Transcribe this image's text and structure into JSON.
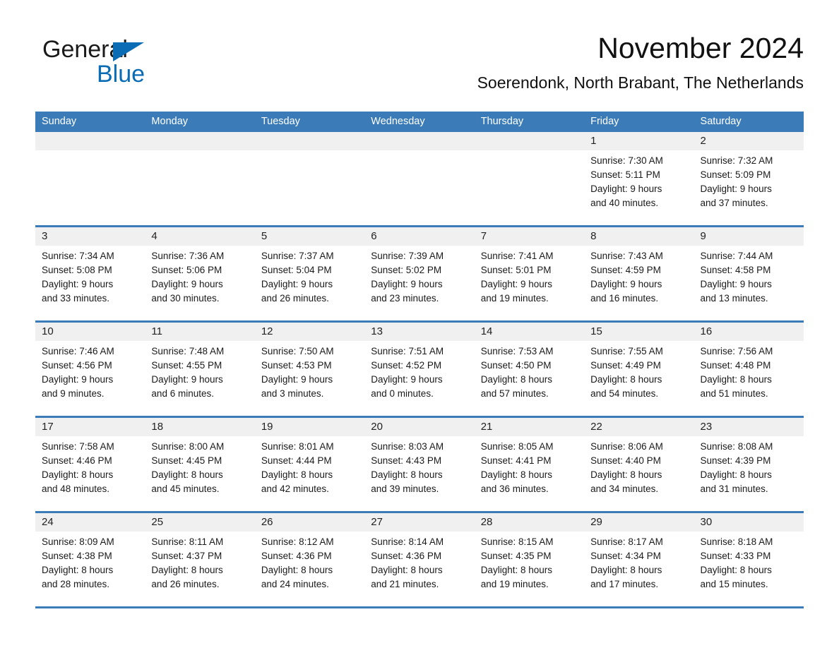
{
  "brand": {
    "name_part1": "General",
    "name_part2": "Blue",
    "triangle_color": "#0a6cb5"
  },
  "header": {
    "title": "November 2024",
    "subtitle": "Soerendonk, North Brabant, The Netherlands"
  },
  "theme": {
    "header_blue": "#3b7cb8",
    "day_band_gray": "#f0f0f0",
    "text": "#1a1a1a"
  },
  "weekdays": [
    "Sunday",
    "Monday",
    "Tuesday",
    "Wednesday",
    "Thursday",
    "Friday",
    "Saturday"
  ],
  "weeks": [
    [
      {
        "day": "",
        "empty": true,
        "sunrise": "",
        "sunset": "",
        "daylight_line1": "",
        "daylight_line2": ""
      },
      {
        "day": "",
        "empty": true,
        "sunrise": "",
        "sunset": "",
        "daylight_line1": "",
        "daylight_line2": ""
      },
      {
        "day": "",
        "empty": true,
        "sunrise": "",
        "sunset": "",
        "daylight_line1": "",
        "daylight_line2": ""
      },
      {
        "day": "",
        "empty": true,
        "sunrise": "",
        "sunset": "",
        "daylight_line1": "",
        "daylight_line2": ""
      },
      {
        "day": "",
        "empty": true,
        "sunrise": "",
        "sunset": "",
        "daylight_line1": "",
        "daylight_line2": ""
      },
      {
        "day": "1",
        "empty": false,
        "sunrise": "Sunrise: 7:30 AM",
        "sunset": "Sunset: 5:11 PM",
        "daylight_line1": "Daylight: 9 hours",
        "daylight_line2": "and 40 minutes."
      },
      {
        "day": "2",
        "empty": false,
        "sunrise": "Sunrise: 7:32 AM",
        "sunset": "Sunset: 5:09 PM",
        "daylight_line1": "Daylight: 9 hours",
        "daylight_line2": "and 37 minutes."
      }
    ],
    [
      {
        "day": "3",
        "empty": false,
        "sunrise": "Sunrise: 7:34 AM",
        "sunset": "Sunset: 5:08 PM",
        "daylight_line1": "Daylight: 9 hours",
        "daylight_line2": "and 33 minutes."
      },
      {
        "day": "4",
        "empty": false,
        "sunrise": "Sunrise: 7:36 AM",
        "sunset": "Sunset: 5:06 PM",
        "daylight_line1": "Daylight: 9 hours",
        "daylight_line2": "and 30 minutes."
      },
      {
        "day": "5",
        "empty": false,
        "sunrise": "Sunrise: 7:37 AM",
        "sunset": "Sunset: 5:04 PM",
        "daylight_line1": "Daylight: 9 hours",
        "daylight_line2": "and 26 minutes."
      },
      {
        "day": "6",
        "empty": false,
        "sunrise": "Sunrise: 7:39 AM",
        "sunset": "Sunset: 5:02 PM",
        "daylight_line1": "Daylight: 9 hours",
        "daylight_line2": "and 23 minutes."
      },
      {
        "day": "7",
        "empty": false,
        "sunrise": "Sunrise: 7:41 AM",
        "sunset": "Sunset: 5:01 PM",
        "daylight_line1": "Daylight: 9 hours",
        "daylight_line2": "and 19 minutes."
      },
      {
        "day": "8",
        "empty": false,
        "sunrise": "Sunrise: 7:43 AM",
        "sunset": "Sunset: 4:59 PM",
        "daylight_line1": "Daylight: 9 hours",
        "daylight_line2": "and 16 minutes."
      },
      {
        "day": "9",
        "empty": false,
        "sunrise": "Sunrise: 7:44 AM",
        "sunset": "Sunset: 4:58 PM",
        "daylight_line1": "Daylight: 9 hours",
        "daylight_line2": "and 13 minutes."
      }
    ],
    [
      {
        "day": "10",
        "empty": false,
        "sunrise": "Sunrise: 7:46 AM",
        "sunset": "Sunset: 4:56 PM",
        "daylight_line1": "Daylight: 9 hours",
        "daylight_line2": "and 9 minutes."
      },
      {
        "day": "11",
        "empty": false,
        "sunrise": "Sunrise: 7:48 AM",
        "sunset": "Sunset: 4:55 PM",
        "daylight_line1": "Daylight: 9 hours",
        "daylight_line2": "and 6 minutes."
      },
      {
        "day": "12",
        "empty": false,
        "sunrise": "Sunrise: 7:50 AM",
        "sunset": "Sunset: 4:53 PM",
        "daylight_line1": "Daylight: 9 hours",
        "daylight_line2": "and 3 minutes."
      },
      {
        "day": "13",
        "empty": false,
        "sunrise": "Sunrise: 7:51 AM",
        "sunset": "Sunset: 4:52 PM",
        "daylight_line1": "Daylight: 9 hours",
        "daylight_line2": "and 0 minutes."
      },
      {
        "day": "14",
        "empty": false,
        "sunrise": "Sunrise: 7:53 AM",
        "sunset": "Sunset: 4:50 PM",
        "daylight_line1": "Daylight: 8 hours",
        "daylight_line2": "and 57 minutes."
      },
      {
        "day": "15",
        "empty": false,
        "sunrise": "Sunrise: 7:55 AM",
        "sunset": "Sunset: 4:49 PM",
        "daylight_line1": "Daylight: 8 hours",
        "daylight_line2": "and 54 minutes."
      },
      {
        "day": "16",
        "empty": false,
        "sunrise": "Sunrise: 7:56 AM",
        "sunset": "Sunset: 4:48 PM",
        "daylight_line1": "Daylight: 8 hours",
        "daylight_line2": "and 51 minutes."
      }
    ],
    [
      {
        "day": "17",
        "empty": false,
        "sunrise": "Sunrise: 7:58 AM",
        "sunset": "Sunset: 4:46 PM",
        "daylight_line1": "Daylight: 8 hours",
        "daylight_line2": "and 48 minutes."
      },
      {
        "day": "18",
        "empty": false,
        "sunrise": "Sunrise: 8:00 AM",
        "sunset": "Sunset: 4:45 PM",
        "daylight_line1": "Daylight: 8 hours",
        "daylight_line2": "and 45 minutes."
      },
      {
        "day": "19",
        "empty": false,
        "sunrise": "Sunrise: 8:01 AM",
        "sunset": "Sunset: 4:44 PM",
        "daylight_line1": "Daylight: 8 hours",
        "daylight_line2": "and 42 minutes."
      },
      {
        "day": "20",
        "empty": false,
        "sunrise": "Sunrise: 8:03 AM",
        "sunset": "Sunset: 4:43 PM",
        "daylight_line1": "Daylight: 8 hours",
        "daylight_line2": "and 39 minutes."
      },
      {
        "day": "21",
        "empty": false,
        "sunrise": "Sunrise: 8:05 AM",
        "sunset": "Sunset: 4:41 PM",
        "daylight_line1": "Daylight: 8 hours",
        "daylight_line2": "and 36 minutes."
      },
      {
        "day": "22",
        "empty": false,
        "sunrise": "Sunrise: 8:06 AM",
        "sunset": "Sunset: 4:40 PM",
        "daylight_line1": "Daylight: 8 hours",
        "daylight_line2": "and 34 minutes."
      },
      {
        "day": "23",
        "empty": false,
        "sunrise": "Sunrise: 8:08 AM",
        "sunset": "Sunset: 4:39 PM",
        "daylight_line1": "Daylight: 8 hours",
        "daylight_line2": "and 31 minutes."
      }
    ],
    [
      {
        "day": "24",
        "empty": false,
        "sunrise": "Sunrise: 8:09 AM",
        "sunset": "Sunset: 4:38 PM",
        "daylight_line1": "Daylight: 8 hours",
        "daylight_line2": "and 28 minutes."
      },
      {
        "day": "25",
        "empty": false,
        "sunrise": "Sunrise: 8:11 AM",
        "sunset": "Sunset: 4:37 PM",
        "daylight_line1": "Daylight: 8 hours",
        "daylight_line2": "and 26 minutes."
      },
      {
        "day": "26",
        "empty": false,
        "sunrise": "Sunrise: 8:12 AM",
        "sunset": "Sunset: 4:36 PM",
        "daylight_line1": "Daylight: 8 hours",
        "daylight_line2": "and 24 minutes."
      },
      {
        "day": "27",
        "empty": false,
        "sunrise": "Sunrise: 8:14 AM",
        "sunset": "Sunset: 4:36 PM",
        "daylight_line1": "Daylight: 8 hours",
        "daylight_line2": "and 21 minutes."
      },
      {
        "day": "28",
        "empty": false,
        "sunrise": "Sunrise: 8:15 AM",
        "sunset": "Sunset: 4:35 PM",
        "daylight_line1": "Daylight: 8 hours",
        "daylight_line2": "and 19 minutes."
      },
      {
        "day": "29",
        "empty": false,
        "sunrise": "Sunrise: 8:17 AM",
        "sunset": "Sunset: 4:34 PM",
        "daylight_line1": "Daylight: 8 hours",
        "daylight_line2": "and 17 minutes."
      },
      {
        "day": "30",
        "empty": false,
        "sunrise": "Sunrise: 8:18 AM",
        "sunset": "Sunset: 4:33 PM",
        "daylight_line1": "Daylight: 8 hours",
        "daylight_line2": "and 15 minutes."
      }
    ]
  ]
}
